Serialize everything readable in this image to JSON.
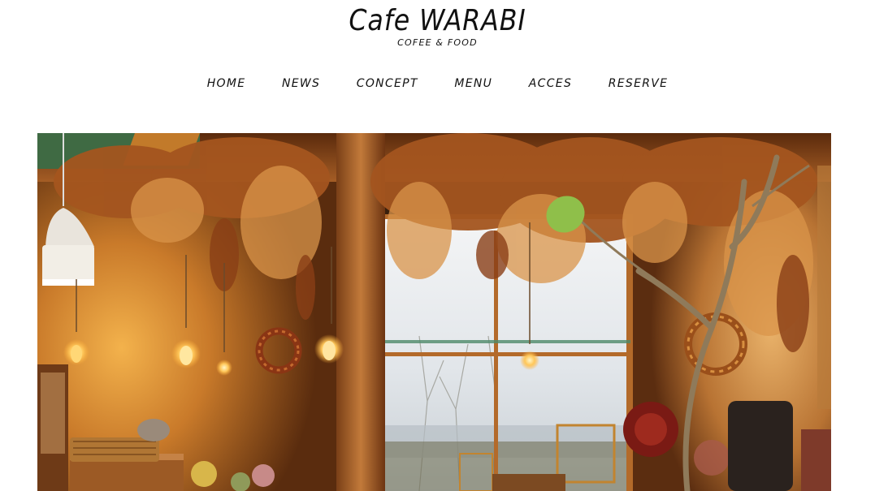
{
  "site": {
    "title": "Cafe WARABI",
    "subtitle": "COFEE & FOOD"
  },
  "nav": {
    "items": [
      {
        "label": "HOME"
      },
      {
        "label": "NEWS"
      },
      {
        "label": "CONCEPT"
      },
      {
        "label": "MENU"
      },
      {
        "label": "ACCES"
      },
      {
        "label": "RESERVE"
      }
    ]
  },
  "hero": {
    "image": "cafe-interior-photo",
    "colors": {
      "wall_warm": "#c27a2e",
      "wood": "#a55d25",
      "window": "#e8ebee",
      "dried_flowers": "#b0642a"
    }
  }
}
